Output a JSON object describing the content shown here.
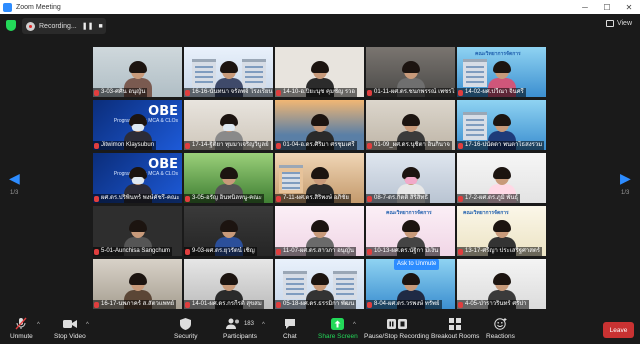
{
  "window": {
    "title": "Zoom Meeting",
    "minimize": "─",
    "maximize": "☐",
    "close": "✕"
  },
  "topbar": {
    "recording_label": "Recording...",
    "pause_glyph": "❚❚",
    "stop_glyph": "■",
    "view_label": "View"
  },
  "pagination": {
    "left": "1/3",
    "right": "1/3"
  },
  "tiles": [
    {
      "name": "3-03-ศศิน อนุญัน"
    },
    {
      "name": "16-16-นั่นทนา จรัลพจ์ โรงเรียน"
    },
    {
      "name": "14-10-อ.ปิยะนุช คุมชัญ รวอ"
    },
    {
      "name": "01-11-ผศ.ดร.ชนกพรรณ์ เพชรไก"
    },
    {
      "name": "14-02-ผศ.ปวีณา จินศรี"
    },
    {
      "name": "Jitwimon Klaysubun"
    },
    {
      "name": "17-14-ฐิติยา ทุมมาเจริญวิบูลย์"
    },
    {
      "name": "01-04-อ.ดร.ศิริมา ศรชุมเศรี"
    },
    {
      "name": "01-09_ผศ.ดร.นุชิตา อินกินาจ"
    },
    {
      "name": "17-16-ปนัดดา พนตาไธสงรวม"
    },
    {
      "name": "ผศ.ดร.ปริพินทร์ พงษ์คัชรี-คณะ"
    },
    {
      "name": "3-05-อรัญ อินทนิลหนู-คณะ"
    },
    {
      "name": "7-11-ผศ.ดร.สิริพงษ์ อภิชัย"
    },
    {
      "name": "08-7-ดร.กิตติ สิริสิทธิ์"
    },
    {
      "name": "17-2-ผศ.ดร.ภูมิ พันธุ์"
    },
    {
      "name": "5-01-Aunchisa Sangchum"
    },
    {
      "name": "9-03-ผศ.ดร.ยุวรัตน์ เชิญ"
    },
    {
      "name": "11-07-ผศ.ดร.สาวภา อนุญัน"
    },
    {
      "name": "10-13-ผศ.ดร.นัฐิกา มีเงิน"
    },
    {
      "name": "13-17-ศรีญา ประเสริฐศาสตร์"
    },
    {
      "name": "16-17-นพภาคร์ ส.สัตวแพทย์"
    },
    {
      "name": "14-01-ผศ.ดร.กรกีรติ สุขสม"
    },
    {
      "name": "05-18-ผศ.ดร.ธรรมิกา พัฒน"
    },
    {
      "name": "8-04-ผศ.ดร.วรพงษ์ ทรัพย์"
    },
    {
      "name": "4-05-ป่าราวรินทร์ ศรัปา"
    }
  ],
  "banners": {
    "obe_title": "OBE",
    "obe_sub": "Program PLOs\nMCA & CLOs",
    "faculty_header": "คณะวิทยาการจัดการ",
    "ask_to_unmute": "Ask to Unmute"
  },
  "toolbar": {
    "unmute": "Unmute",
    "stop_video": "Stop Video",
    "security": "Security",
    "participants": "Participants",
    "participants_count": "183",
    "chat": "Chat",
    "share_screen": "Share Screen",
    "pause_stop_recording": "Pause/Stop Recording",
    "breakout_rooms": "Breakout Rooms",
    "reactions": "Reactions",
    "leave": "Leave"
  },
  "colors": {
    "accent": "#2d8cff",
    "share": "#23d959",
    "leave": "#c93232",
    "muted_mic": "#e03e3e"
  }
}
